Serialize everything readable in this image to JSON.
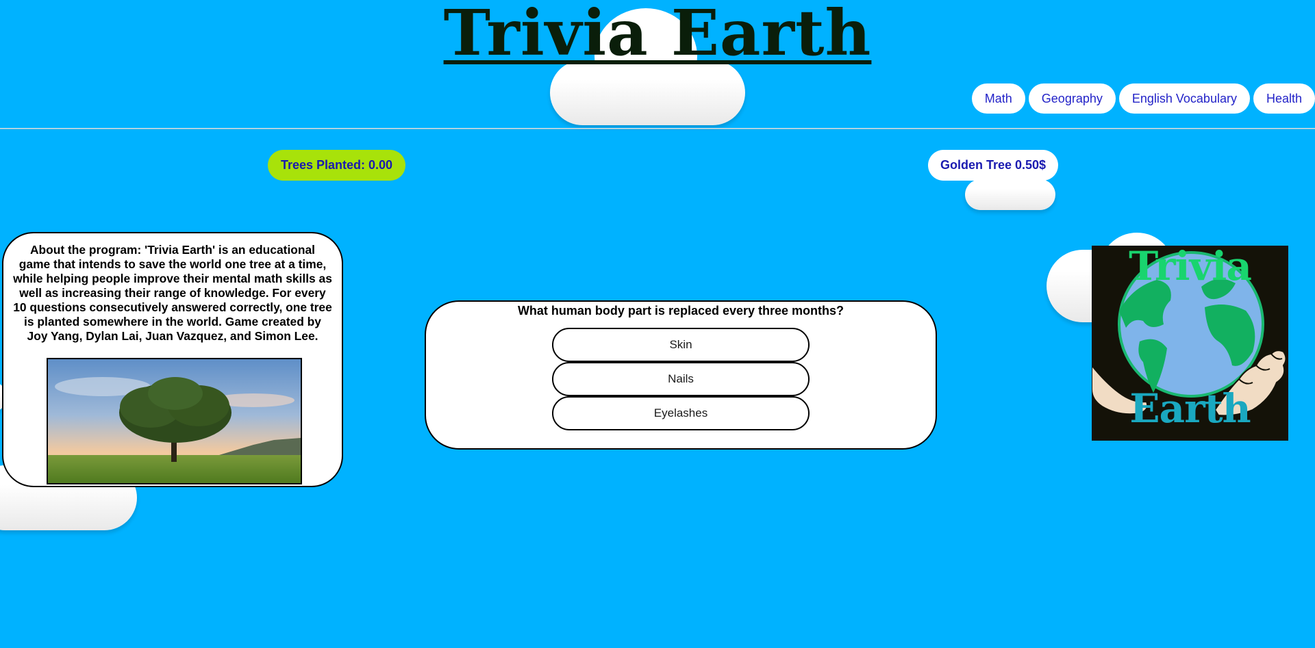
{
  "site": {
    "title": "Trivia Earth"
  },
  "nav": {
    "items": [
      {
        "label": "Math"
      },
      {
        "label": "Geography"
      },
      {
        "label": "English Vocabulary"
      },
      {
        "label": "Health"
      }
    ]
  },
  "stats": {
    "trees_planted_label": "Trees Planted: 0.00",
    "golden_tree_label": "Golden Tree 0.50$"
  },
  "about": {
    "text": "About the program: 'Trivia Earth' is an educational game that intends to save the world one tree at a time, while helping people improve their mental math skills as well as increasing their range of knowledge. For every 10 questions consecutively answered correctly, one tree is planted somewhere in the world. Game created by Joy Yang, Dylan Lai, Juan Vazquez, and Simon Lee.",
    "image_icon": "tree-photo"
  },
  "quiz": {
    "question": "What human body part is replaced every three months?",
    "answers": [
      {
        "label": "Skin"
      },
      {
        "label": "Nails"
      },
      {
        "label": "Eyelashes"
      }
    ]
  },
  "logo": {
    "top_word": "Trivia",
    "bottom_word": "Earth"
  },
  "colors": {
    "background": "#00b2ff",
    "trees_pill": "#a8e20a",
    "nav_text": "#2323c8",
    "logo_green": "#19c878",
    "logo_teal": "#1aa8b8"
  }
}
